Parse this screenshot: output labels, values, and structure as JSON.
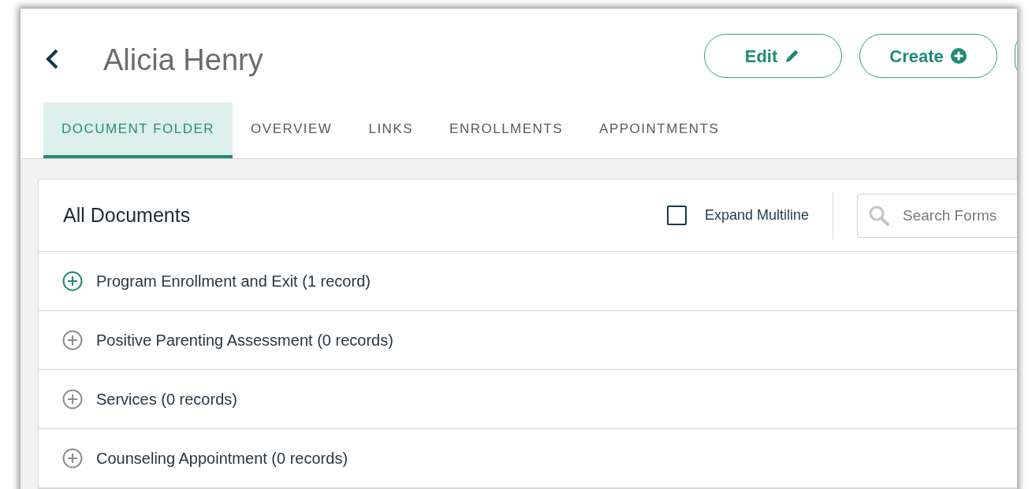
{
  "header": {
    "title": "Alicia Henry",
    "buttons": [
      "Edit",
      "Create"
    ]
  },
  "tabs": [
    {
      "label": "DOCUMENT FOLDER",
      "selected": true
    },
    {
      "label": "OVERVIEW",
      "selected": false
    },
    {
      "label": "LINKS",
      "selected": false
    },
    {
      "label": "ENROLLMENTS",
      "selected": false
    },
    {
      "label": "APPOINTMENTS",
      "selected": false
    }
  ],
  "panel": {
    "title": "All Documents",
    "expand_multiline": {
      "label": "Expand Multiline",
      "checked": false
    },
    "search": {
      "placeholder": "Search Forms"
    },
    "rows": [
      {
        "label": "Program Enrollment and Exit (1 record)",
        "active": true
      },
      {
        "label": "Positive Parenting Assessment (0 records)",
        "active": false
      },
      {
        "label": "Services (0 records)",
        "active": false
      },
      {
        "label": "Counseling Appointment (0 records)",
        "active": false
      }
    ]
  }
}
